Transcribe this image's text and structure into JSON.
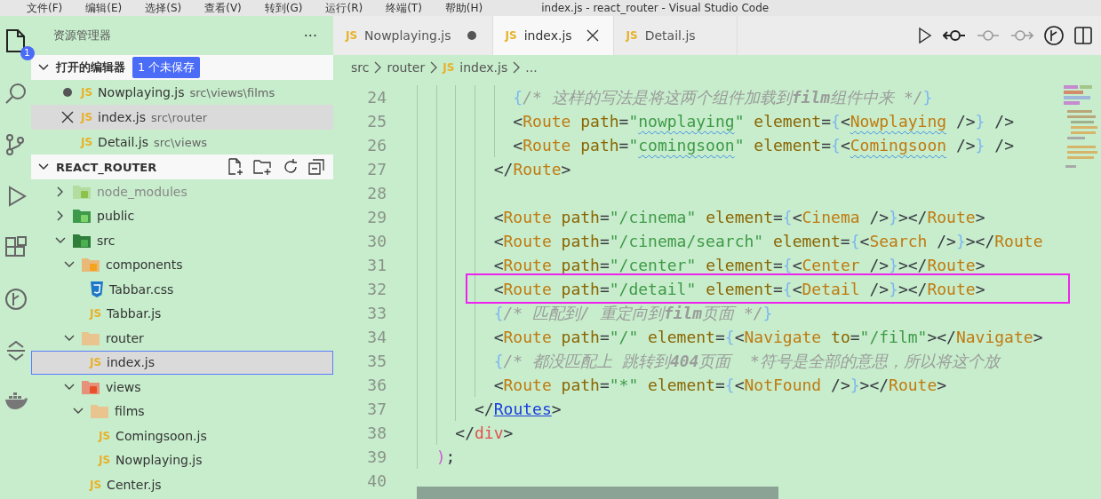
{
  "menu": [
    "文件(F)",
    "编辑(E)",
    "选择(S)",
    "查看(V)",
    "转到(G)",
    "运行(R)",
    "终端(T)",
    "帮助(H)"
  ],
  "window": {
    "title": "index.js - react_router - Visual Studio Code"
  },
  "activity_bar": [
    {
      "kind": "explorer",
      "selected": true,
      "badge": "1"
    },
    {
      "kind": "search",
      "selected": false
    },
    {
      "kind": "source-control",
      "selected": false
    },
    {
      "kind": "run",
      "selected": false
    },
    {
      "kind": "extensions",
      "selected": false
    },
    {
      "kind": "git-graph",
      "selected": false
    },
    {
      "kind": "timeline",
      "selected": false
    },
    {
      "kind": "docker",
      "selected": false
    }
  ],
  "sidebar": {
    "title": "资源管理器",
    "more": "···",
    "open_editors": {
      "label": "打开的编辑器",
      "badge": "1 个未保存",
      "expanded": true,
      "items": [
        {
          "icon_text": "JS",
          "name": "Nowplaying.js",
          "path": "src\\views\\films",
          "dirty": true,
          "selected": false
        },
        {
          "icon_text": "JS",
          "name": "index.js",
          "path": "src\\router",
          "dirty": false,
          "selected": true
        },
        {
          "icon_text": "JS",
          "name": "Detail.js",
          "path": "src\\views",
          "dirty": false,
          "selected": false
        }
      ]
    },
    "explorer": {
      "label": "REACT_ROUTER",
      "expanded": true,
      "tree": [
        {
          "kind": "folder-node",
          "name": "node_modules",
          "expanded": false,
          "ignored": true,
          "selected": false
        },
        {
          "kind": "folder-public",
          "name": "public",
          "expanded": false,
          "ignored": false,
          "selected": false
        },
        {
          "kind": "folder-src",
          "name": "src",
          "expanded": true,
          "ignored": false,
          "selected": false,
          "children": [
            {
              "kind": "folder-components",
              "name": "components",
              "expanded": true,
              "ignored": false,
              "selected": false,
              "children": [
                {
                  "kind": "css",
                  "name": "Tabbar.css",
                  "ignored": false,
                  "selected": false
                },
                {
                  "kind": "js",
                  "icon_text": "JS",
                  "name": "Tabbar.js",
                  "ignored": false,
                  "selected": false
                }
              ]
            },
            {
              "kind": "folder",
              "name": "router",
              "expanded": true,
              "ignored": false,
              "selected": false,
              "children": [
                {
                  "kind": "js",
                  "icon_text": "JS",
                  "name": "index.js",
                  "ignored": false,
                  "selected": true
                }
              ]
            },
            {
              "kind": "folder-views",
              "name": "views",
              "expanded": true,
              "ignored": false,
              "selected": false,
              "children": [
                {
                  "kind": "folder",
                  "name": "films",
                  "expanded": true,
                  "ignored": false,
                  "selected": false,
                  "children": [
                    {
                      "kind": "js",
                      "icon_text": "JS",
                      "name": "Comingsoon.js",
                      "ignored": false,
                      "selected": false
                    },
                    {
                      "kind": "js",
                      "icon_text": "JS",
                      "name": "Nowplaying.js",
                      "ignored": false,
                      "selected": false
                    }
                  ]
                },
                {
                  "kind": "js",
                  "icon_text": "JS",
                  "name": "Center.js",
                  "ignored": false,
                  "selected": false
                }
              ]
            }
          ]
        }
      ]
    }
  },
  "tabs": [
    {
      "icon_text": "JS",
      "label": "Nowplaying.js",
      "dirty": true,
      "selected": false
    },
    {
      "icon_text": "JS",
      "label": "index.js",
      "dirty": false,
      "selected": true
    },
    {
      "icon_text": "JS",
      "label": "Detail.js",
      "dirty": false,
      "selected": false
    }
  ],
  "breadcrumb": [
    {
      "text": "src"
    },
    {
      "text": "router"
    },
    {
      "text": "index.js",
      "icon_text": "JS"
    },
    {
      "text": "..."
    }
  ],
  "editor": {
    "lines": [
      {
        "number": "24",
        "tokens": [
          {
            "kind": "brace",
            "text": "          {"
          },
          {
            "kind": "comment",
            "text": "/* 这样的写法是将这两个组件加载到**film**组件中来 */"
          },
          {
            "kind": "brace",
            "text": "}"
          }
        ]
      },
      {
        "number": "25",
        "tokens": [
          {
            "kind": "p",
            "text": "          <"
          },
          {
            "kind": "tag",
            "text": "Route"
          },
          {
            "kind": "attr",
            "text": " path"
          },
          {
            "kind": "p",
            "text": "="
          },
          {
            "kind": "str",
            "text": "\""
          },
          {
            "kind": "str",
            "text": "nowplaying",
            "squiggle": true
          },
          {
            "kind": "str",
            "text": "\""
          },
          {
            "kind": "attr",
            "text": " element"
          },
          {
            "kind": "p",
            "text": "="
          },
          {
            "kind": "brace",
            "text": "{"
          },
          {
            "kind": "p",
            "text": "<"
          },
          {
            "kind": "tag",
            "text": "Nowplaying",
            "squiggle": true
          },
          {
            "kind": "p",
            "text": " />"
          },
          {
            "kind": "brace",
            "text": "}"
          },
          {
            "kind": "p",
            "text": " />"
          }
        ]
      },
      {
        "number": "26",
        "tokens": [
          {
            "kind": "p",
            "text": "          <"
          },
          {
            "kind": "tag",
            "text": "Route"
          },
          {
            "kind": "attr",
            "text": " path"
          },
          {
            "kind": "p",
            "text": "="
          },
          {
            "kind": "str",
            "text": "\""
          },
          {
            "kind": "str",
            "text": "comingsoon",
            "squiggle": true
          },
          {
            "kind": "str",
            "text": "\""
          },
          {
            "kind": "attr",
            "text": " element"
          },
          {
            "kind": "p",
            "text": "="
          },
          {
            "kind": "brace",
            "text": "{"
          },
          {
            "kind": "p",
            "text": "<"
          },
          {
            "kind": "tag",
            "text": "Comingsoon",
            "squiggle": true
          },
          {
            "kind": "p",
            "text": " />"
          },
          {
            "kind": "brace",
            "text": "}"
          },
          {
            "kind": "p",
            "text": " />"
          }
        ]
      },
      {
        "number": "27",
        "tokens": [
          {
            "kind": "p",
            "text": "        </"
          },
          {
            "kind": "tag",
            "text": "Route"
          },
          {
            "kind": "p",
            "text": ">"
          }
        ]
      },
      {
        "number": "28"
      },
      {
        "number": "29",
        "tokens": [
          {
            "kind": "p",
            "text": "        <"
          },
          {
            "kind": "tag",
            "text": "Route"
          },
          {
            "kind": "attr",
            "text": " path"
          },
          {
            "kind": "p",
            "text": "="
          },
          {
            "kind": "str",
            "text": "\"/cinema\""
          },
          {
            "kind": "attr",
            "text": " element"
          },
          {
            "kind": "p",
            "text": "="
          },
          {
            "kind": "brace",
            "text": "{"
          },
          {
            "kind": "p",
            "text": "<"
          },
          {
            "kind": "tag",
            "text": "Cinema"
          },
          {
            "kind": "p",
            "text": " />"
          },
          {
            "kind": "brace",
            "text": "}"
          },
          {
            "kind": "p",
            "text": "></"
          },
          {
            "kind": "tag",
            "text": "Route"
          },
          {
            "kind": "p",
            "text": ">"
          }
        ]
      },
      {
        "number": "30",
        "tokens": [
          {
            "kind": "p",
            "text": "        <"
          },
          {
            "kind": "tag",
            "text": "Route"
          },
          {
            "kind": "attr",
            "text": " path"
          },
          {
            "kind": "p",
            "text": "="
          },
          {
            "kind": "str",
            "text": "\"/cinema/search\""
          },
          {
            "kind": "attr",
            "text": " element"
          },
          {
            "kind": "p",
            "text": "="
          },
          {
            "kind": "brace",
            "text": "{"
          },
          {
            "kind": "p",
            "text": "<"
          },
          {
            "kind": "tag",
            "text": "Search"
          },
          {
            "kind": "p",
            "text": " />"
          },
          {
            "kind": "brace",
            "text": "}"
          },
          {
            "kind": "p",
            "text": "></"
          },
          {
            "kind": "tag",
            "text": "Route"
          }
        ]
      },
      {
        "number": "31",
        "tokens": [
          {
            "kind": "p",
            "text": "        <"
          },
          {
            "kind": "tag",
            "text": "Route"
          },
          {
            "kind": "attr",
            "text": " path"
          },
          {
            "kind": "p",
            "text": "="
          },
          {
            "kind": "str",
            "text": "\"/center\""
          },
          {
            "kind": "attr",
            "text": " element"
          },
          {
            "kind": "p",
            "text": "="
          },
          {
            "kind": "brace",
            "text": "{"
          },
          {
            "kind": "p",
            "text": "<"
          },
          {
            "kind": "tag",
            "text": "Center"
          },
          {
            "kind": "p",
            "text": " />"
          },
          {
            "kind": "brace",
            "text": "}"
          },
          {
            "kind": "p",
            "text": "></"
          },
          {
            "kind": "tag",
            "text": "Route"
          },
          {
            "kind": "p",
            "text": ">"
          }
        ]
      },
      {
        "number": "32",
        "highlighted": true,
        "tokens": [
          {
            "kind": "p",
            "text": "        <"
          },
          {
            "kind": "tag",
            "text": "Route"
          },
          {
            "kind": "attr",
            "text": " path"
          },
          {
            "kind": "p",
            "text": "="
          },
          {
            "kind": "str",
            "text": "\"/detail\""
          },
          {
            "kind": "attr",
            "text": " element"
          },
          {
            "kind": "p",
            "text": "="
          },
          {
            "kind": "brace",
            "text": "{"
          },
          {
            "kind": "p",
            "text": "<"
          },
          {
            "kind": "tag",
            "text": "Detail"
          },
          {
            "kind": "p",
            "text": " />"
          },
          {
            "kind": "brace",
            "text": "}"
          },
          {
            "kind": "p",
            "text": "></"
          },
          {
            "kind": "tag",
            "text": "Route"
          },
          {
            "kind": "p",
            "text": ">"
          }
        ]
      },
      {
        "number": "33",
        "tokens": [
          {
            "kind": "brace",
            "text": "        {"
          },
          {
            "kind": "comment",
            "text": "/* 匹配到/ 重定向到**film**页面 */"
          },
          {
            "kind": "brace",
            "text": "}"
          }
        ]
      },
      {
        "number": "34",
        "tokens": [
          {
            "kind": "p",
            "text": "        <"
          },
          {
            "kind": "tag",
            "text": "Route"
          },
          {
            "kind": "attr",
            "text": " path"
          },
          {
            "kind": "p",
            "text": "="
          },
          {
            "kind": "str",
            "text": "\"/\""
          },
          {
            "kind": "attr",
            "text": " element"
          },
          {
            "kind": "p",
            "text": "="
          },
          {
            "kind": "brace",
            "text": "{"
          },
          {
            "kind": "p",
            "text": "<"
          },
          {
            "kind": "tag",
            "text": "Navigate"
          },
          {
            "kind": "attr",
            "text": " to"
          },
          {
            "kind": "p",
            "text": "="
          },
          {
            "kind": "str",
            "text": "\"/film\""
          },
          {
            "kind": "p",
            "text": "></"
          },
          {
            "kind": "tag",
            "text": "Navigate"
          },
          {
            "kind": "p",
            "text": ">"
          }
        ]
      },
      {
        "number": "35",
        "tokens": [
          {
            "kind": "brace",
            "text": "        {"
          },
          {
            "kind": "comment",
            "text": "/* 都没匹配上 跳转到**404**页面  *符号是全部的意思，所以将这个放"
          }
        ]
      },
      {
        "number": "36",
        "tokens": [
          {
            "kind": "p",
            "text": "        <"
          },
          {
            "kind": "tag",
            "text": "Route"
          },
          {
            "kind": "attr",
            "text": " path"
          },
          {
            "kind": "p",
            "text": "="
          },
          {
            "kind": "str",
            "text": "\"*\""
          },
          {
            "kind": "attr",
            "text": " element"
          },
          {
            "kind": "p",
            "text": "="
          },
          {
            "kind": "brace",
            "text": "{"
          },
          {
            "kind": "p",
            "text": "<"
          },
          {
            "kind": "tag",
            "text": "NotFound"
          },
          {
            "kind": "p",
            "text": " />"
          },
          {
            "kind": "brace",
            "text": "}"
          },
          {
            "kind": "p",
            "text": "></"
          },
          {
            "kind": "tag",
            "text": "Route"
          },
          {
            "kind": "p",
            "text": ">"
          }
        ]
      },
      {
        "number": "37",
        "tokens": [
          {
            "kind": "p",
            "text": "      </"
          },
          {
            "kind": "link",
            "text": "Routes"
          },
          {
            "kind": "p",
            "text": ">"
          }
        ]
      },
      {
        "number": "38",
        "tokens": [
          {
            "kind": "p",
            "text": "    </"
          },
          {
            "kind": "html",
            "text": "div"
          },
          {
            "kind": "p",
            "text": ">"
          }
        ]
      },
      {
        "number": "39",
        "tokens": [
          {
            "kind": "paren",
            "text": "  )"
          },
          {
            "kind": "p",
            "text": ";"
          }
        ]
      },
      {
        "number": "40"
      }
    ]
  }
}
